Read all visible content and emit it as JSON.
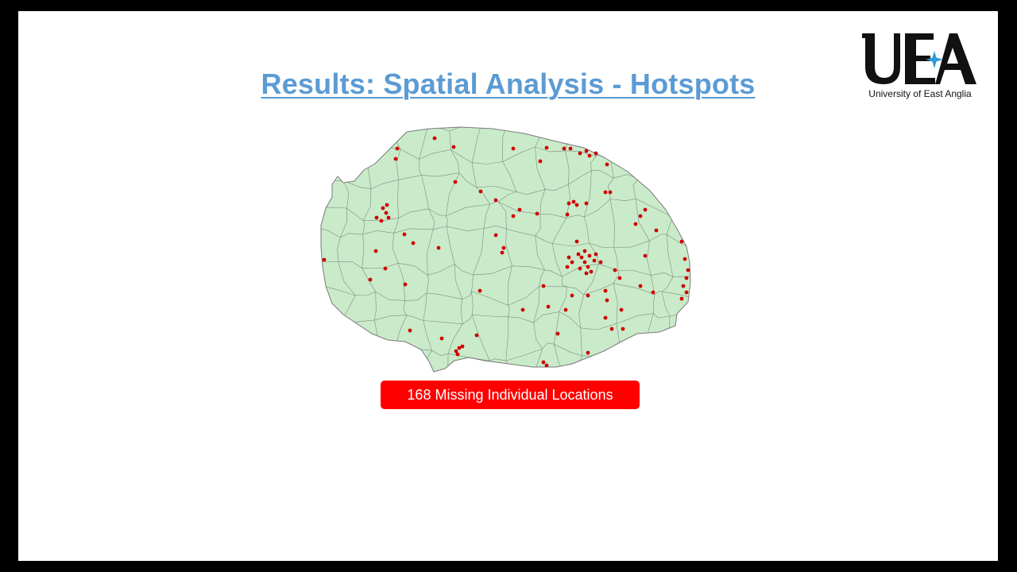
{
  "slide": {
    "title": "Results: Spatial Analysis - Hotspots"
  },
  "logo": {
    "letters": "UEA",
    "caption": "University of East Anglia",
    "star_color": "#2c9ad8"
  },
  "map": {
    "region_fill": "#c9ebc9",
    "boundary_color": "#6b6b6b",
    "point_color": "#d00000"
  },
  "badge": {
    "label": "168 Missing Individual Locations",
    "color": "#ff0000"
  }
}
